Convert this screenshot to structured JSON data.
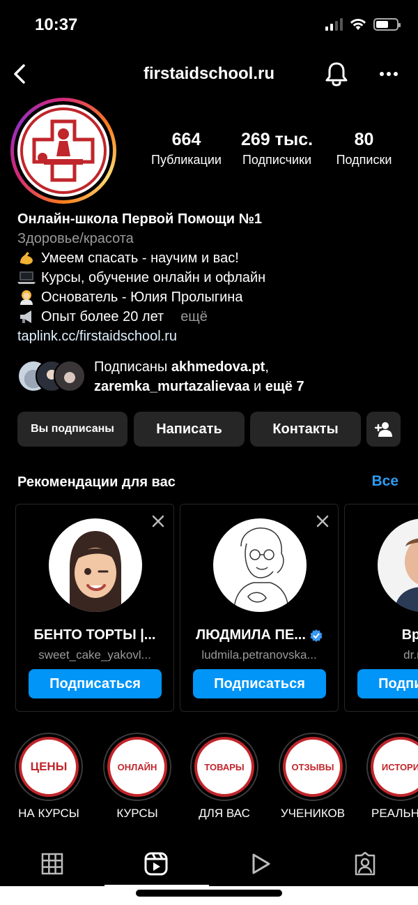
{
  "status_bar": {
    "time": "10:37"
  },
  "nav": {
    "title": "firstaidschool.ru"
  },
  "stats": [
    {
      "value": "664",
      "label": "Публикации"
    },
    {
      "value": "269 тыс.",
      "label": "Подписчики"
    },
    {
      "value": "80",
      "label": "Подписки"
    }
  ],
  "bio": {
    "name": "Онлайн-школа Первой Помощи №1",
    "category": "Здоровье/красота",
    "lines": [
      {
        "icon": "flexed-biceps-icon",
        "text": "Умеем спасать - научим и вас!"
      },
      {
        "icon": "laptop-icon",
        "text": "Курсы, обучение онлайн и офлайн"
      },
      {
        "icon": "woman-health-worker-icon",
        "text": "Основатель - Юлия Пролыгина"
      },
      {
        "icon": "megaphone-icon",
        "text": "Опыт более 20 лет"
      }
    ],
    "more": "ещё",
    "link": "taplink.cc/firstaidschool.ru"
  },
  "followed_by": {
    "prefix": "Подписаны",
    "user1": "akhmedova.pt",
    "user2": "zaremka_murtazalievaa",
    "connector": "и",
    "suffix": "ещё 7"
  },
  "buttons": {
    "following": "Вы подписаны",
    "message": "Написать",
    "contacts": "Контакты"
  },
  "recommendations": {
    "title": "Рекомендации для вас",
    "see_all": "Все",
    "follow_label": "Подписаться",
    "cards": [
      {
        "name": "БЕНТО ТОРТЫ |...",
        "username": "sweet_cake_yakovl...",
        "verified": false
      },
      {
        "name": "ЛЮДМИЛА ПЕ...",
        "username": "ludmila.petranovska...",
        "verified": true
      },
      {
        "name": "Врач г",
        "username": "dr.roma",
        "verified": false
      }
    ]
  },
  "highlights": [
    {
      "cover": "ЦЕНЫ",
      "label": "НА КУРСЫ"
    },
    {
      "cover": "ОНЛАЙН",
      "label": "КУРСЫ"
    },
    {
      "cover": "ТОВАРЫ",
      "label": "ДЛЯ ВАС"
    },
    {
      "cover": "ОТЗЫВЫ",
      "label": "УЧЕНИКОВ"
    },
    {
      "cover": "ИСТОРИ",
      "label": "РЕАЛЬНЫ"
    }
  ],
  "colors": {
    "accent_blue": "#0095f6",
    "link_blue": "#2f9bf0",
    "brand_red": "#c0262b",
    "button_gray": "#262626"
  }
}
